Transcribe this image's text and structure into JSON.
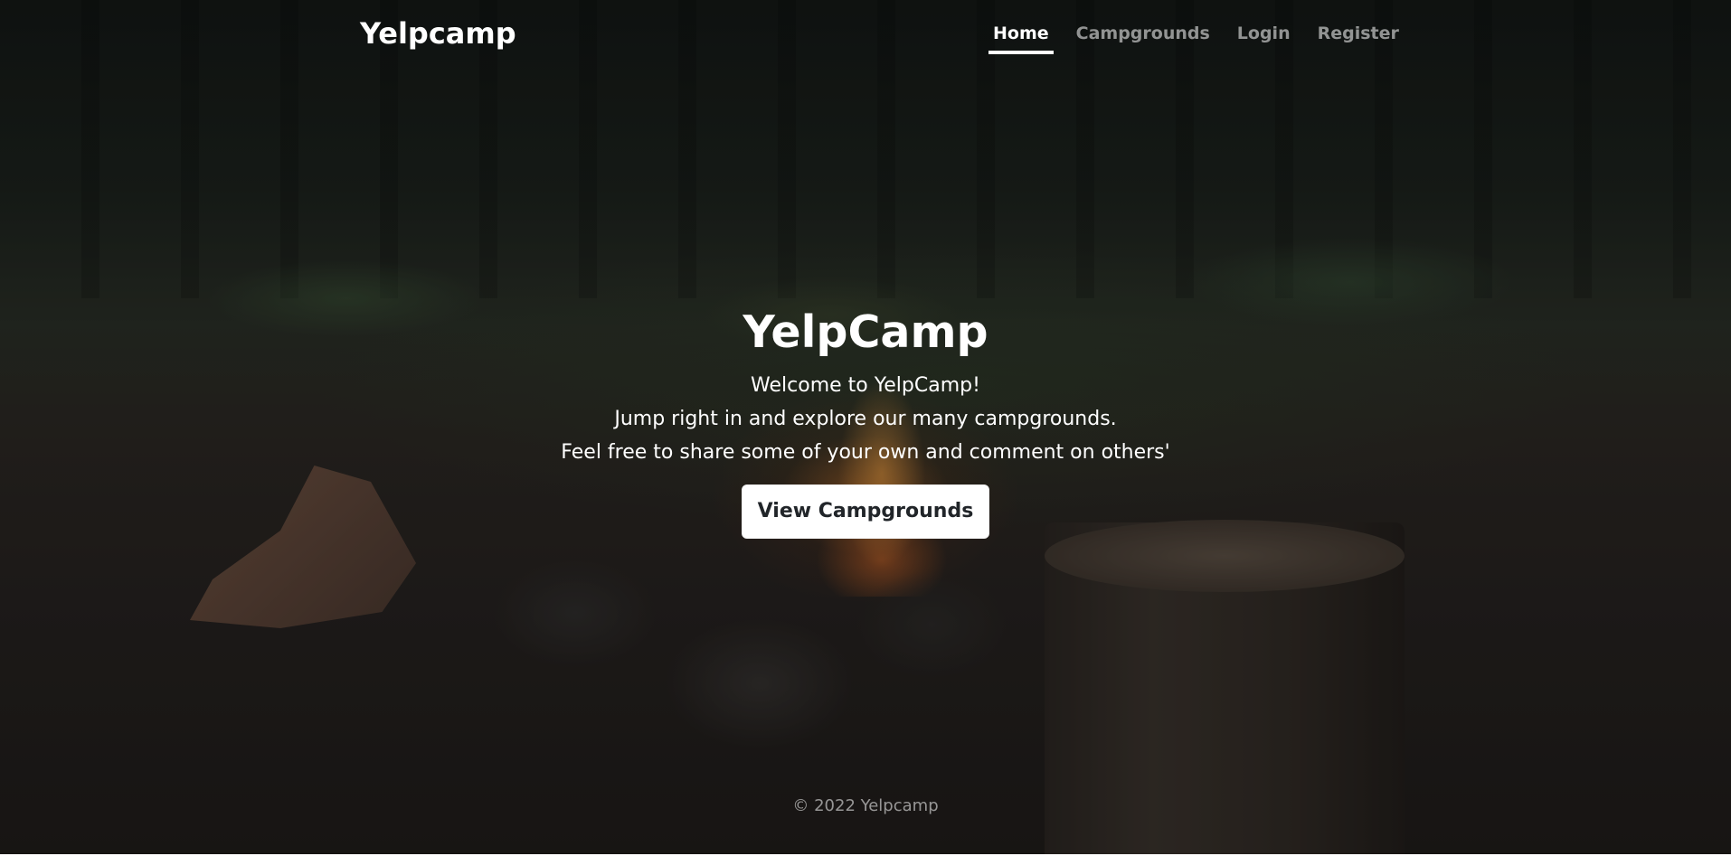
{
  "header": {
    "brand": "Yelpcamp",
    "nav": [
      {
        "label": "Home",
        "active": true
      },
      {
        "label": "Campgrounds",
        "active": false
      },
      {
        "label": "Login",
        "active": false
      },
      {
        "label": "Register",
        "active": false
      }
    ]
  },
  "hero": {
    "title": "YelpCamp",
    "lines": [
      "Welcome to YelpCamp!",
      "Jump right in and explore our many campgrounds.",
      "Feel free to share some of your own and comment on others'"
    ],
    "button_label": "View Campgrounds"
  },
  "footer": {
    "text": "© 2022 Yelpcamp"
  },
  "colors": {
    "text": "#ffffff",
    "muted_nav": "rgba(255,255,255,0.55)",
    "button_bg": "#ffffff",
    "button_text": "#212529"
  }
}
